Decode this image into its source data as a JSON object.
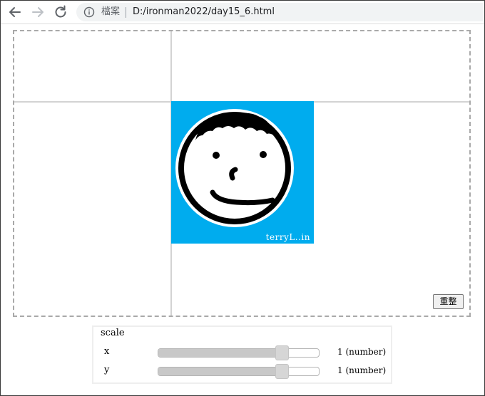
{
  "browser": {
    "back_icon": "arrow-left-icon",
    "forward_icon": "arrow-right-icon",
    "reload_icon": "reload-icon",
    "info_icon": "info-circle-icon",
    "scheme_label": "檔案",
    "url": "D:/ironman2022/day15_6.html"
  },
  "stage": {
    "avatar_signature": "terryL..in",
    "avatar_bg_color": "#00acee",
    "reset_label": "重整"
  },
  "panel": {
    "title": "scale",
    "sliders": [
      {
        "label": "x",
        "value_text": "1 (number)",
        "value": 1,
        "min": 0,
        "max": 1.2,
        "level": 0.77
      },
      {
        "label": "y",
        "value_text": "1 (number)",
        "value": 1,
        "min": 0,
        "max": 1.2,
        "level": 0.77
      }
    ]
  }
}
